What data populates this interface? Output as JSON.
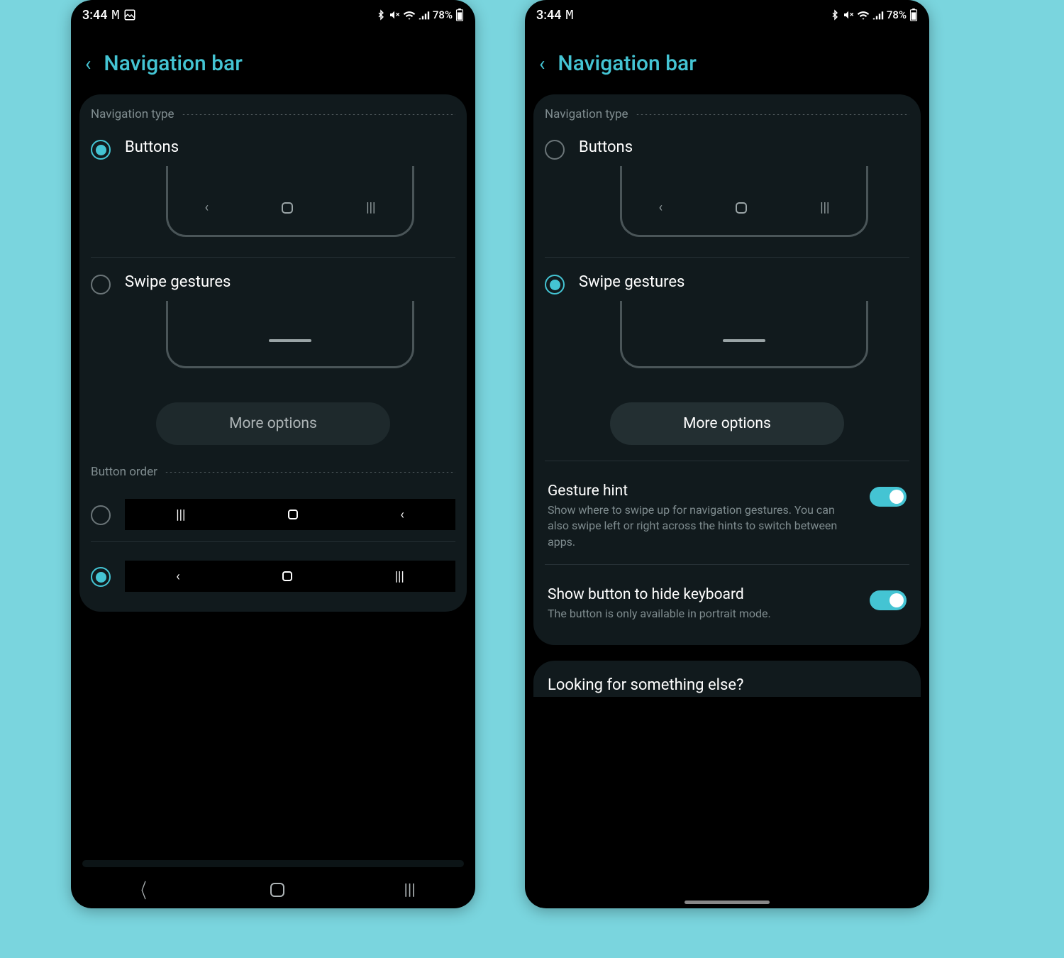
{
  "page": {
    "background": "#7ad5de"
  },
  "phones": [
    {
      "status": {
        "time": "3:44",
        "battery": "78%"
      },
      "header": {
        "title": "Navigation bar"
      },
      "nav_type": {
        "heading": "Navigation type",
        "buttons": {
          "label": "Buttons",
          "selected": true
        },
        "swipe": {
          "label": "Swipe gestures",
          "selected": false
        },
        "more": "More options",
        "more_enabled": false
      },
      "button_order": {
        "heading": "Button order",
        "option_a_selected": false,
        "option_b_selected": true
      }
    },
    {
      "status": {
        "time": "3:44",
        "battery": "78%"
      },
      "header": {
        "title": "Navigation bar"
      },
      "nav_type": {
        "heading": "Navigation type",
        "buttons": {
          "label": "Buttons",
          "selected": false
        },
        "swipe": {
          "label": "Swipe gestures",
          "selected": true
        },
        "more": "More options",
        "more_enabled": true
      },
      "toggles": {
        "gesture_hint": {
          "title": "Gesture hint",
          "desc": "Show where to swipe up for navigation gestures. You can also swipe left or right across the hints to switch between apps.",
          "on": true
        },
        "hide_keyboard": {
          "title": "Show button to hide keyboard",
          "desc": "The button is only available in portrait mode.",
          "on": true
        }
      },
      "looking": {
        "text": "Looking for something else?"
      }
    }
  ]
}
